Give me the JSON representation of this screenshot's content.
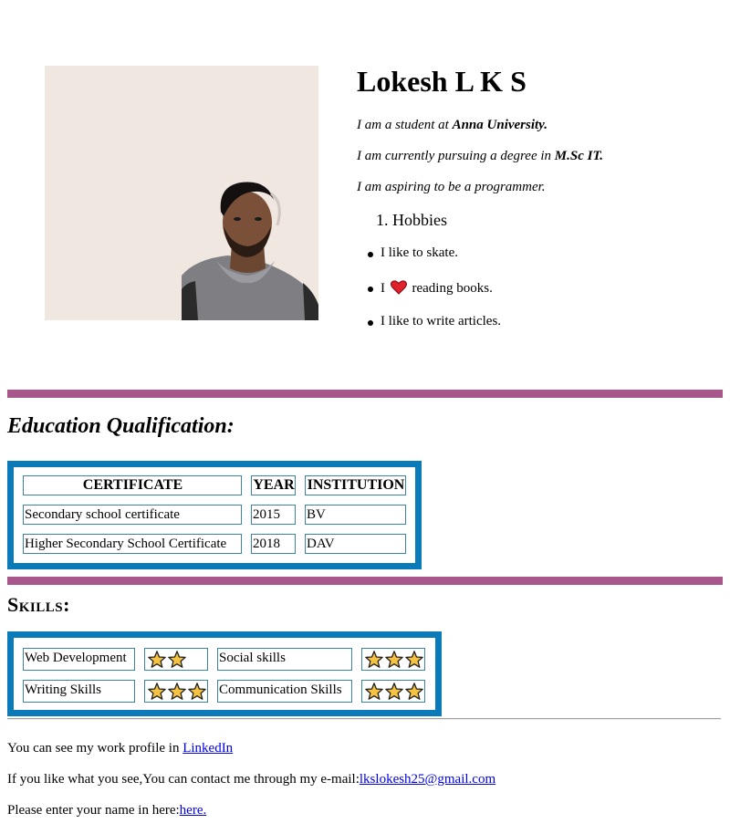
{
  "profile": {
    "name": "Lokesh L K S",
    "intro1_prefix": "I am a student at ",
    "intro1_bold": "Anna University.",
    "intro2_prefix": "I am currently pursuing a degree in ",
    "intro2_bold": "M.Sc IT.",
    "intro3": "I am aspiring to be a programmer.",
    "list_heading": "Hobbies",
    "hobby1": "I like to skate.",
    "hobby2_prefix": "I",
    "hobby2_suffix": "reading books.",
    "hobby3": "I like to write articles."
  },
  "education": {
    "heading": "Education Qualification:",
    "headers": [
      "CERTIFICATE",
      "YEAR",
      "INSTITUTION"
    ],
    "rows": [
      [
        "Secondary school certificate",
        "2015",
        "BV"
      ],
      [
        "Higher Secondary School Certificate",
        "2018",
        "DAV"
      ]
    ]
  },
  "skills": {
    "heading": "Skills:",
    "items": [
      {
        "name": "Web Development",
        "stars": 2
      },
      {
        "name": "Social skills",
        "stars": 3
      },
      {
        "name": "Writing Skills",
        "stars": 3
      },
      {
        "name": "Communication Skills",
        "stars": 3
      }
    ]
  },
  "footer": {
    "line1_prefix": "You can see my work profile in ",
    "line1_link": "LinkedIn",
    "line2_prefix": "If you like what you see,You can contact me through my e-mail:",
    "line2_link": "lkslokesh25@gmail.com",
    "line3_prefix": "Please enter your name in here:",
    "line3_link": "here."
  },
  "colors": {
    "divider": "#a8578d",
    "frame": "#0b7ab8",
    "star": "#f5c242",
    "heart": "#e0202a"
  },
  "icons": [
    "heart-icon",
    "star-icon"
  ]
}
